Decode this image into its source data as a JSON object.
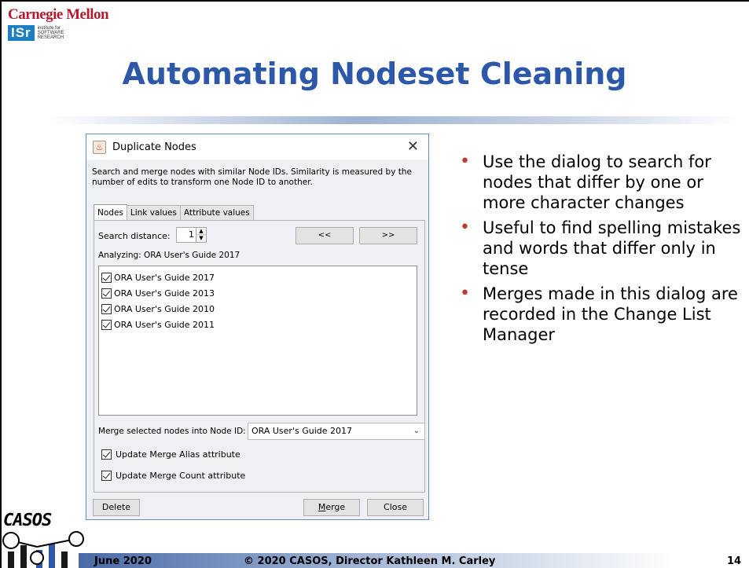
{
  "header": {
    "university": "Carnegie Mellon",
    "isr_mark": "ISr",
    "isr_text": [
      "institute for",
      "SOFTWARE",
      "RESEARCH"
    ]
  },
  "slide": {
    "title": "Automating Nodeset Cleaning",
    "bullets": [
      "Use the dialog to search for nodes that differ by one or more character changes",
      "Useful to find spelling mistakes and words that differ only in tense",
      "Merges made in this dialog are recorded in the Change List Manager"
    ]
  },
  "dialog": {
    "title": "Duplicate Nodes",
    "close_glyph": "✕",
    "description": "Search and merge nodes with similar Node IDs. Similarity is measured by the number of edits to transform one Node ID to another.",
    "tabs": [
      "Nodes",
      "Link values",
      "Attribute values"
    ],
    "active_tab": "Nodes",
    "search_distance_label": "Search distance:",
    "search_distance_value": "1",
    "prev_label": "<<",
    "next_label": ">>",
    "analyzing": "Analyzing: ORA User's Guide 2017",
    "nodes": [
      {
        "label": "ORA User's Guide 2017",
        "checked": true
      },
      {
        "label": "ORA User's Guide 2013",
        "checked": true
      },
      {
        "label": "ORA User's Guide 2010",
        "checked": true
      },
      {
        "label": "ORA User's Guide 2011",
        "checked": true
      }
    ],
    "merge_into_label": "Merge selected nodes into Node ID:",
    "merge_into_value": "ORA User's Guide 2017",
    "opt_alias": "Update Merge Alias attribute",
    "opt_count": "Update Merge Count attribute",
    "delete_label": "Delete",
    "merge_label": "Merge",
    "close_label": "Close"
  },
  "footer": {
    "logo": "CASOS",
    "date": "June 2020",
    "copyright": "© 2020 CASOS, Director Kathleen M. Carley",
    "page": "14"
  }
}
